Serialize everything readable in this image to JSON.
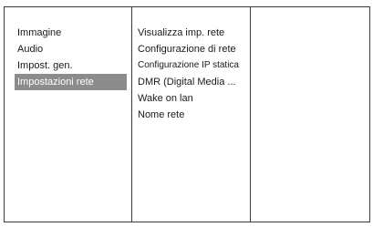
{
  "main_menu": {
    "items": [
      {
        "label": "Immagine"
      },
      {
        "label": "Audio"
      },
      {
        "label": "Impost. gen."
      },
      {
        "label": "Impostazioni rete",
        "selected": true
      }
    ]
  },
  "sub_menu": {
    "items": [
      {
        "label": "Visualizza imp. rete"
      },
      {
        "label": "Configurazione di rete"
      },
      {
        "label": "Configurazione IP statica"
      },
      {
        "label": "DMR (Digital Media ..."
      },
      {
        "label": "Wake on lan"
      },
      {
        "label": "Nome rete"
      }
    ]
  },
  "colors": {
    "border": "#3a3a3a",
    "selected_bg": "#8c8c8c",
    "selected_text": "#ffffff",
    "text": "#1a1a1a"
  }
}
